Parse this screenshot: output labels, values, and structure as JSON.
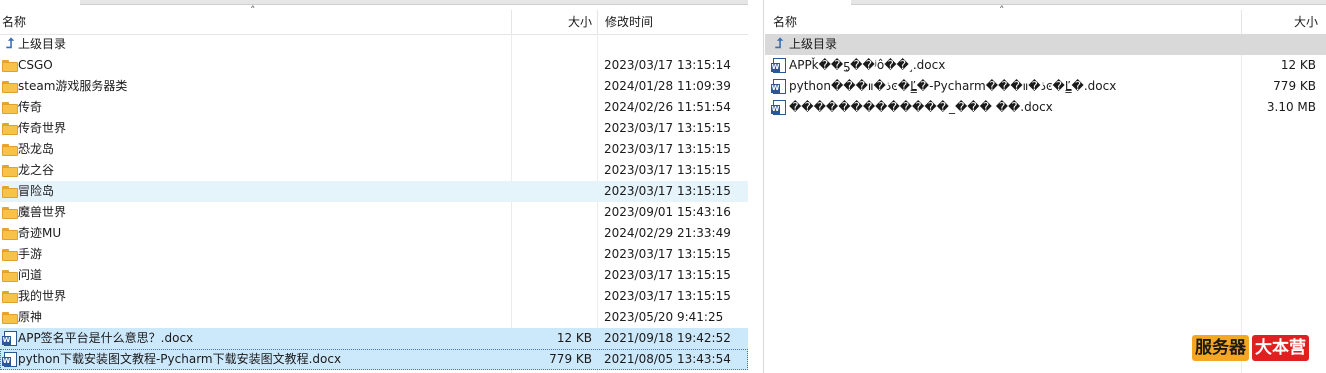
{
  "left": {
    "headers": {
      "name": "名称",
      "size": "大小",
      "modified": "修改时间"
    },
    "up_label": "上级目录",
    "rows": [
      {
        "type": "folder",
        "name": "CSGO",
        "size": "",
        "modified": "2023/03/17 13:15:14"
      },
      {
        "type": "folder",
        "name": "steam游戏服务器类",
        "size": "",
        "modified": "2024/01/28 11:09:39"
      },
      {
        "type": "folder",
        "name": "传奇",
        "size": "",
        "modified": "2024/02/26 11:51:54"
      },
      {
        "type": "folder",
        "name": "传奇世界",
        "size": "",
        "modified": "2023/03/17 13:15:15"
      },
      {
        "type": "folder",
        "name": "恐龙岛",
        "size": "",
        "modified": "2023/03/17 13:15:15"
      },
      {
        "type": "folder",
        "name": "龙之谷",
        "size": "",
        "modified": "2023/03/17 13:15:15"
      },
      {
        "type": "folder",
        "name": "冒险岛",
        "size": "",
        "modified": "2023/03/17 13:15:15"
      },
      {
        "type": "folder",
        "name": "魔兽世界",
        "size": "",
        "modified": "2023/09/01 15:43:16"
      },
      {
        "type": "folder",
        "name": "奇迹MU",
        "size": "",
        "modified": "2024/02/29 21:33:49"
      },
      {
        "type": "folder",
        "name": "手游",
        "size": "",
        "modified": "2023/03/17 13:15:15"
      },
      {
        "type": "folder",
        "name": "问道",
        "size": "",
        "modified": "2023/03/17 13:15:15"
      },
      {
        "type": "folder",
        "name": "我的世界",
        "size": "",
        "modified": "2023/03/17 13:15:15"
      },
      {
        "type": "folder",
        "name": "原神",
        "size": "",
        "modified": "2023/05/20 9:41:25"
      },
      {
        "type": "doc",
        "name": "APP签名平台是什么意思？.docx",
        "size": "12 KB",
        "modified": "2021/09/18 19:42:52"
      },
      {
        "type": "doc",
        "name": "python下载安装图文教程-Pycharm下载安装图文教程.docx",
        "size": "779 KB",
        "modified": "2021/08/05 13:43:54"
      }
    ]
  },
  "right": {
    "headers": {
      "name": "名称",
      "size": "大小"
    },
    "up_label": "上级目录",
    "rows": [
      {
        "type": "doc",
        "name": "APPǩ��ƽ̨��ʲô��˼.docx",
        "size": "12 KB"
      },
      {
        "type": "doc",
        "name": "python���ذ�װͼ�Ľ̳�-Pycharm���ذ�װͼ�Ľ̳�.docx",
        "size": "779 KB"
      },
      {
        "type": "doc",
        "name": "�������������_���    ��.docx",
        "size": "3.10 MB"
      }
    ]
  },
  "watermark": {
    "part1": "服务器",
    "part2": "大本营"
  },
  "icons": {
    "folder": "folder-icon",
    "document": "word-document-icon",
    "up": "up-directory-icon"
  },
  "colors": {
    "hover": "#e5f3fb",
    "selected": "#cce8fb",
    "up_row_selected": "#d9d9d9",
    "folder": "#f7c24a",
    "word": "#2b5797"
  }
}
